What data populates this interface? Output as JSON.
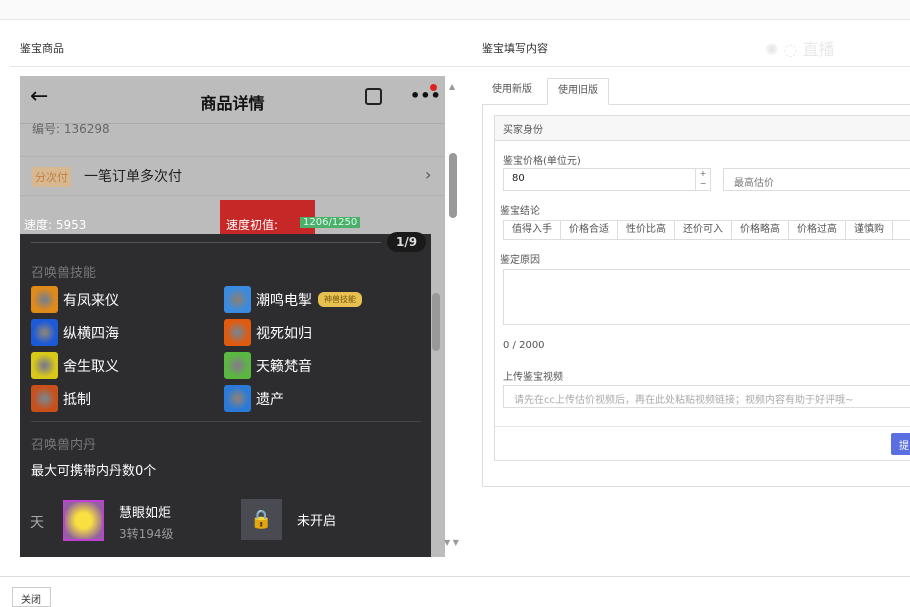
{
  "left": {
    "title": "鉴宝商品",
    "phone": {
      "title": "商品详情",
      "serial": "编号: 136298",
      "pay_tag": "分次付",
      "pay_text": "一笔订单多次付",
      "speed": "速度: 5953",
      "speed_init_label": "速度初值:",
      "speed_init_value": "1206/1250",
      "page": "1/9",
      "skills_title": "召唤兽技能",
      "skills": [
        {
          "name": "有凤来仪",
          "color": "#e08a1a"
        },
        {
          "name": "潮鸣电掣",
          "color": "#3a8be0",
          "badge": "神兽技能"
        },
        {
          "name": "纵横四海",
          "color": "#1d5ad8"
        },
        {
          "name": "视死如归",
          "color": "#e05a10"
        },
        {
          "name": "舍生取义",
          "color": "#d8c81a"
        },
        {
          "name": "天籁梵音",
          "color": "#5ab840"
        },
        {
          "name": "抵制",
          "color": "#c8501a"
        },
        {
          "name": "遗产",
          "color": "#2a7ad8"
        }
      ],
      "neidan_title": "召唤兽内丹",
      "neidan_max": "最大可携带内丹数0个",
      "neidan_tier": "天",
      "neidan_name": "慧眼如炬",
      "neidan_level": "3转194级",
      "locked_label": "未开启"
    }
  },
  "right": {
    "title": "鉴宝填写内容",
    "tabs": [
      "使用新版",
      "使用旧版"
    ],
    "active_tab": 1,
    "buyer_identity": "买家身份",
    "price_label": "鉴宝价格(单位元)",
    "price_value": "80",
    "max_price_placeholder": "最高估价",
    "conclusion_label": "鉴宝结论",
    "conclusions": [
      "值得入手",
      "价格合适",
      "性价比高",
      "还价可入",
      "价格略高",
      "价格过高",
      "谨慎购"
    ],
    "reason_label": "鉴定原因",
    "char_count": "0 / 2000",
    "video_label": "上传鉴宝视频",
    "video_placeholder": "请先在cc上传估价视频后，再在此处粘贴视频链接；视频内容有助于好评哦~",
    "submit_label": "提",
    "accent": "#5b6fe0"
  },
  "footer": {
    "close_label": "关闭"
  },
  "watermark": "CC直播"
}
